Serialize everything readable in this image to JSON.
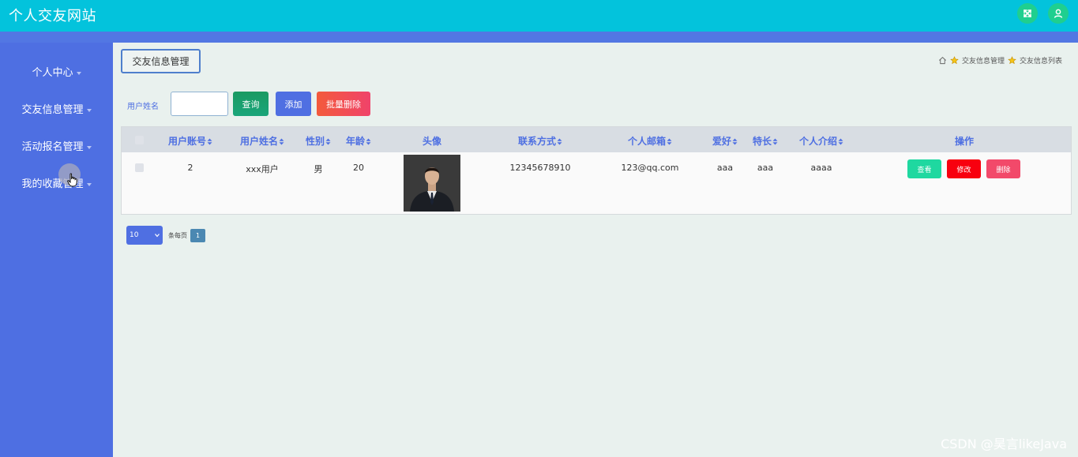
{
  "app": {
    "title": "个人交友网站"
  },
  "sidebar": {
    "items": [
      {
        "label": "个人中心"
      },
      {
        "label": "交友信息管理"
      },
      {
        "label": "活动报名管理"
      },
      {
        "label": "我的收藏管理"
      }
    ]
  },
  "main": {
    "tab_label": "交友信息管理",
    "breadcrumb": [
      "交友信息管理",
      "交友信息列表"
    ],
    "search": {
      "label": "用户姓名",
      "value": "",
      "placeholder": ""
    },
    "buttons": {
      "query": "查询",
      "add": "添加",
      "batch_delete": "批量删除"
    },
    "table": {
      "headers": [
        "用户账号",
        "用户姓名",
        "性别",
        "年龄",
        "头像",
        "联系方式",
        "个人邮箱",
        "爱好",
        "特长",
        "个人介绍",
        "操作"
      ],
      "rows": [
        {
          "account": "2",
          "name": "xxx用户",
          "gender": "男",
          "age": "20",
          "phone": "12345678910",
          "email": "123@qq.com",
          "hobby": "aaa",
          "specialty": "aaa",
          "intro": "aaaa",
          "actions": {
            "view": "查看",
            "edit": "修改",
            "delete": "删除"
          }
        }
      ]
    },
    "pagination": {
      "page_size": "10",
      "per_page_label": "条每页",
      "current_page": "1"
    }
  },
  "watermark": "CSDN @昊言likeJava",
  "colors": {
    "topbar": "#03c3dc",
    "sidebar": "#4e6fe2",
    "accent": "#4f6fe2",
    "view_button": "#1fd8a0",
    "edit_button": "#f8000f",
    "delete_button": "#f2496a"
  }
}
